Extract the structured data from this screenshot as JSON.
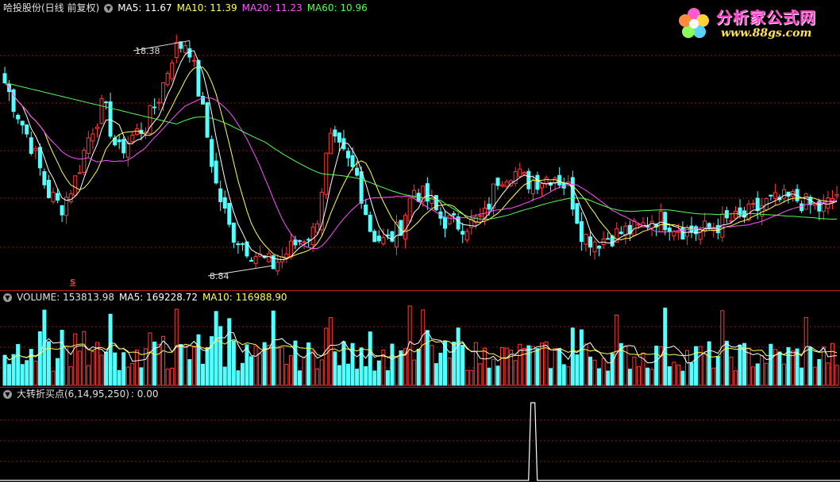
{
  "price_header": {
    "stock": "哈投股份(日线 前复权)",
    "ma5": "MA5: 11.67",
    "ma10": "MA10: 11.39",
    "ma20": "MA20: 11.23",
    "ma60": "MA60: 10.96"
  },
  "volume_header": {
    "volume": "VOLUME: 153813.98",
    "ma5": "MA5: 169228.72",
    "ma10": "MA10: 116988.90"
  },
  "indicator_header": {
    "name": "大转折买点(6,14,95,250)",
    "value": ": 0.00"
  },
  "annotations": {
    "high_label": "18.38",
    "low_label": "8.84",
    "marker": "S"
  },
  "logo": {
    "name": "分析家公式网",
    "url": "www.88gs.com"
  },
  "colors": {
    "up": "#ff3b3b",
    "down": "#54ffff",
    "ma5": "#ffffff",
    "ma10": "#ffff54",
    "ma20": "#ff54ff",
    "ma60": "#54ff54",
    "grid": "#8b1a1a",
    "separator": "#c01818"
  },
  "chart_data": [
    {
      "type": "candlestick",
      "title": "哈投股份(日线 前复权)",
      "ylim": [
        8.0,
        19.5
      ],
      "grid": true,
      "series": [
        {
          "name": "MA5",
          "values": [
            11.67
          ]
        },
        {
          "name": "MA10",
          "values": [
            11.39
          ]
        },
        {
          "name": "MA20",
          "values": [
            11.23
          ]
        },
        {
          "name": "MA60",
          "values": [
            10.96
          ]
        }
      ],
      "annotations": [
        {
          "text": "18.38",
          "value": 18.38,
          "kind": "period high"
        },
        {
          "text": "8.84",
          "value": 8.84,
          "kind": "period low"
        }
      ],
      "trend_points": [
        16.6,
        15.2,
        13.8,
        12.0,
        11.3,
        12.5,
        14.4,
        15.7,
        13.6,
        14.3,
        14.8,
        16.1,
        18.0,
        18.38,
        15.5,
        12.2,
        10.3,
        9.7,
        9.2,
        8.84,
        9.4,
        10.0,
        10.3,
        14.2,
        13.5,
        12.6,
        10.2,
        9.8,
        10.4,
        12.1,
        11.6,
        10.8,
        10.6,
        10.6,
        10.9,
        12.6,
        12.9,
        12.4,
        12.5,
        12.7,
        12.1,
        10.1,
        9.9,
        10.1,
        10.3,
        10.4,
        10.9,
        10.7,
        10.4,
        10.3,
        10.4,
        10.7,
        10.8,
        11.1,
        11.5,
        11.6,
        11.7,
        11.4,
        11.2,
        11.9
      ]
    },
    {
      "type": "bar",
      "title": "VOLUME",
      "series": [
        {
          "name": "VOLUME",
          "values": [
            153813.98
          ]
        },
        {
          "name": "MA5",
          "values": [
            169228.72
          ]
        },
        {
          "name": "MA10",
          "values": [
            116988.9
          ]
        }
      ]
    },
    {
      "type": "line",
      "title": "大转折买点(6,14,95,250)",
      "series": [
        {
          "name": "大转折买点",
          "values": [
            0.0
          ]
        }
      ],
      "annotations": [
        {
          "text": "single spike signal",
          "position_fraction": 0.633
        }
      ]
    }
  ]
}
